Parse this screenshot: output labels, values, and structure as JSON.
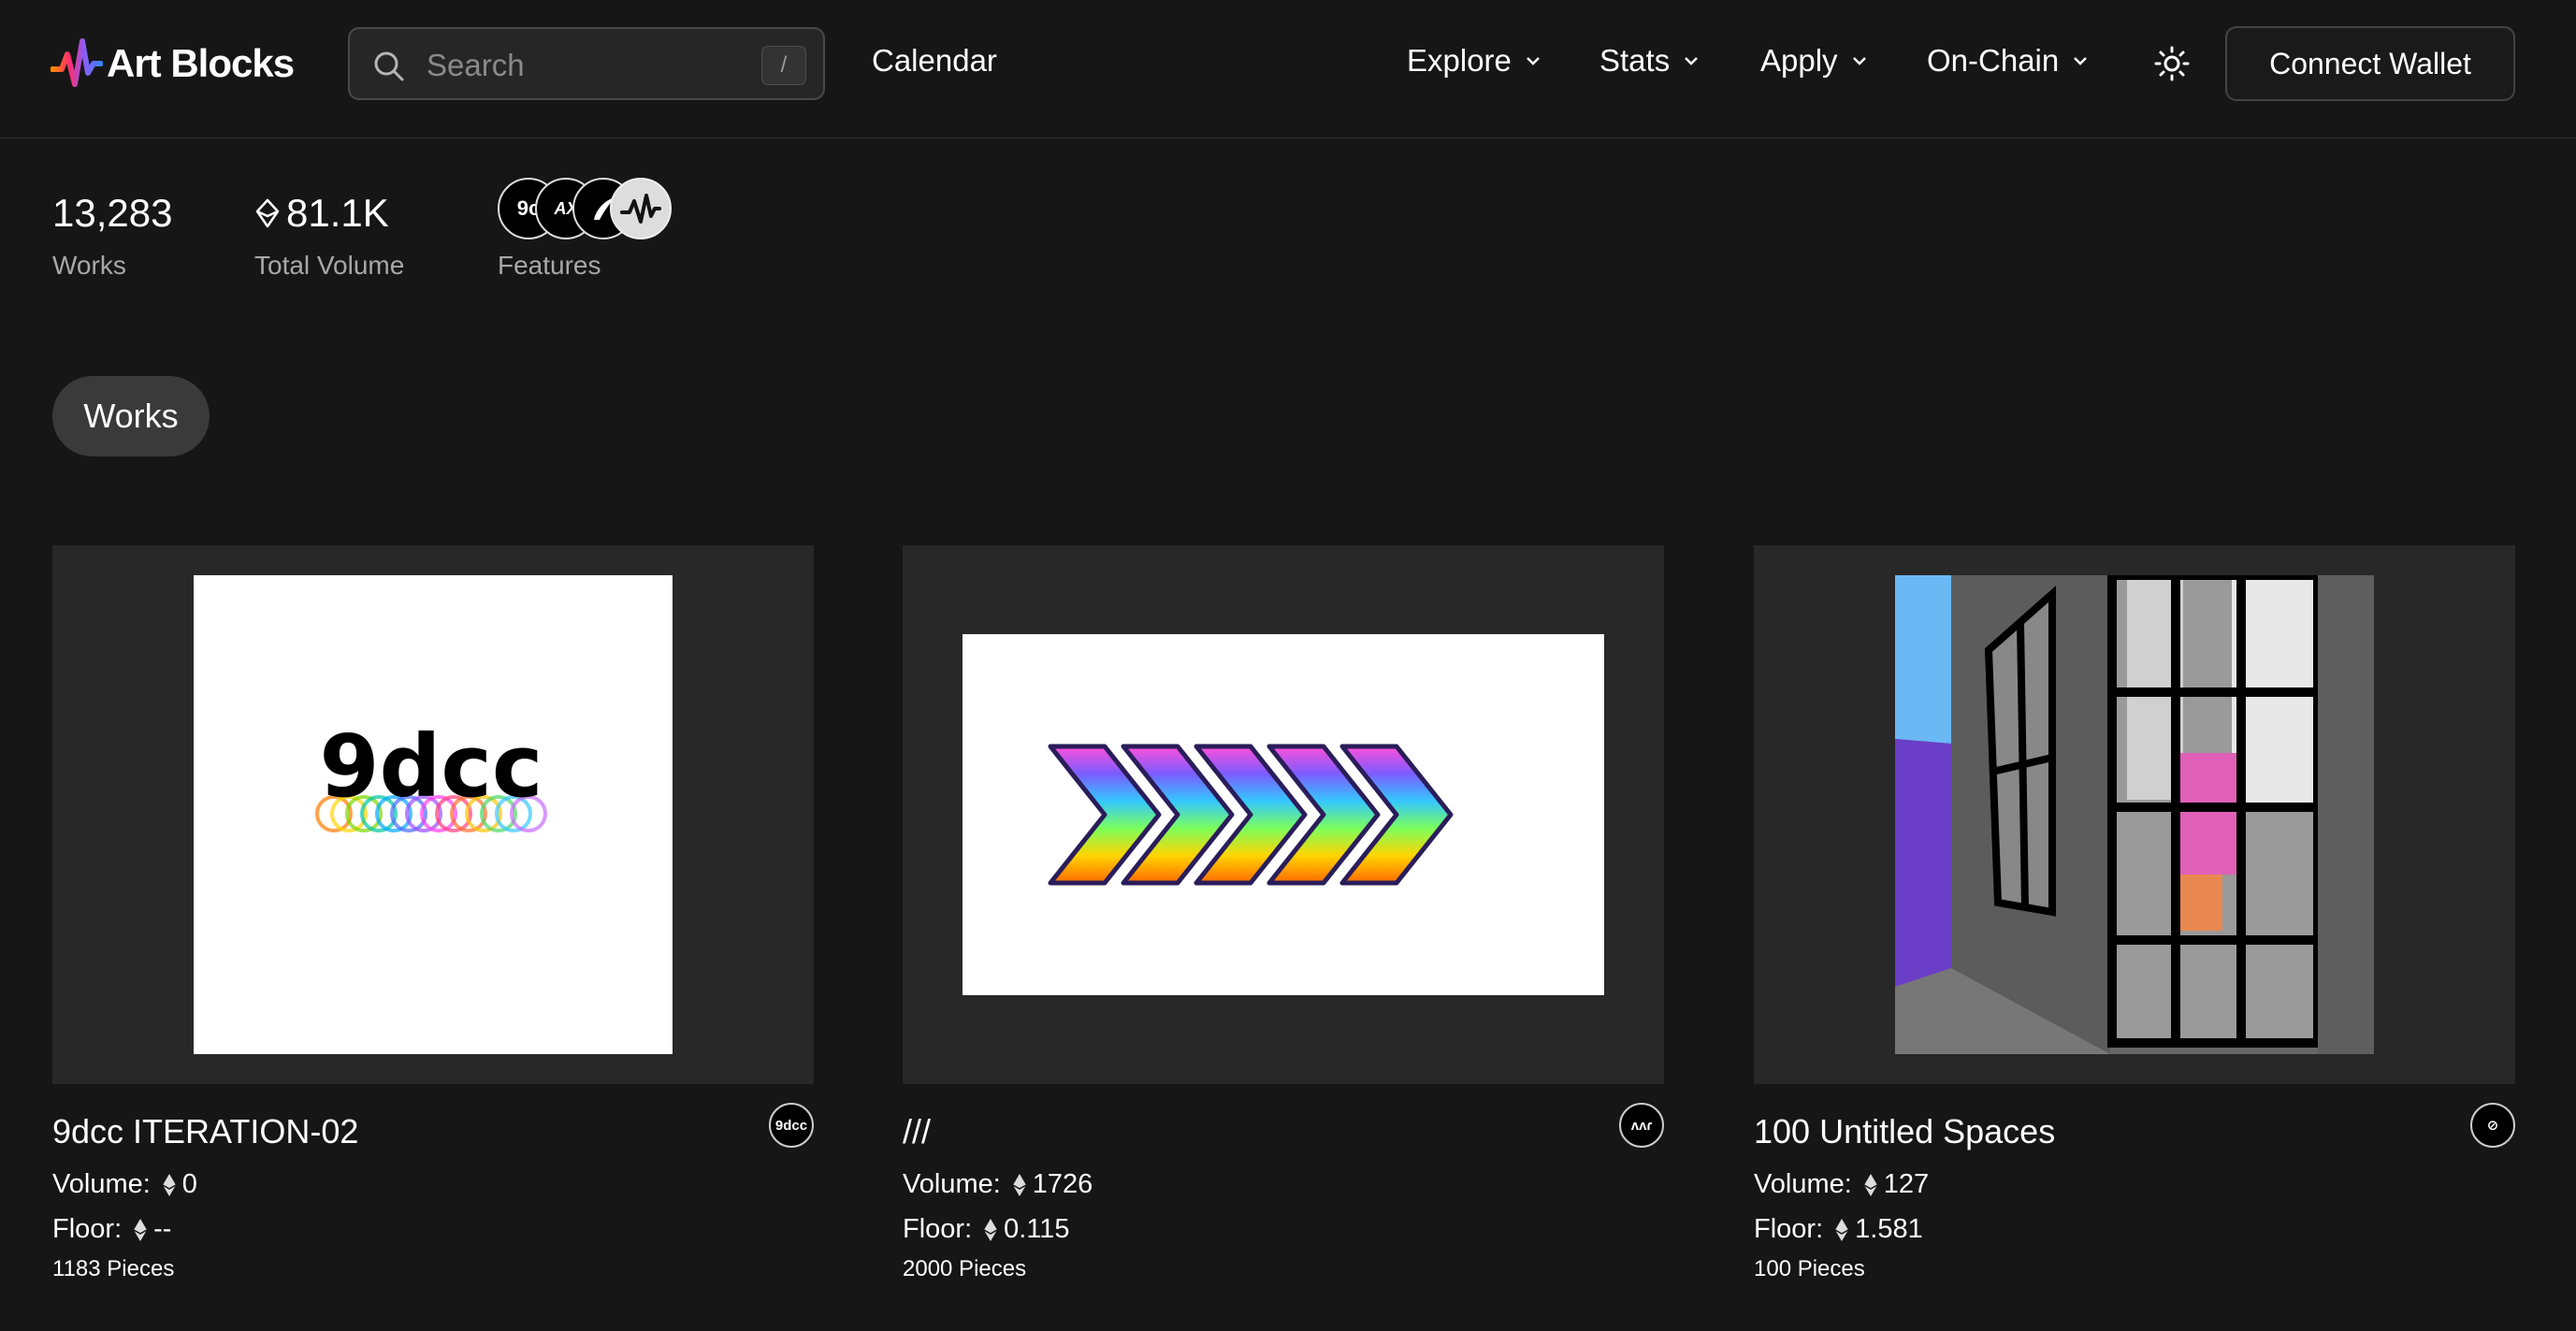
{
  "header": {
    "logo_text": "Art Blocks",
    "search": {
      "placeholder": "Search",
      "shortcut": "/"
    },
    "nav": {
      "calendar": "Calendar",
      "explore": "Explore",
      "stats": "Stats",
      "apply": "Apply",
      "onchain": "On-Chain"
    },
    "connect_wallet": "Connect Wallet"
  },
  "stats": {
    "works_value": "13,283",
    "works_label": "Works",
    "volume_value": "81.1K",
    "volume_label": "Total Volume",
    "features_label": "Features",
    "features": [
      {
        "text": "9c",
        "icon": "9dcc-logo"
      },
      {
        "text": "AX",
        "icon": "ax-logo"
      },
      {
        "text": "",
        "icon": "brush-logo"
      },
      {
        "text": "",
        "icon": "art-blocks-logo"
      }
    ]
  },
  "tabs": {
    "works": "Works"
  },
  "cards": [
    {
      "title": "9dcc ITERATION-02",
      "volume_label": "Volume:",
      "volume": "0",
      "floor_label": "Floor:",
      "floor": "--",
      "pieces": "1183 Pieces",
      "artist_badge": "9dcc",
      "art_text": "9dcc"
    },
    {
      "title": "///",
      "volume_label": "Volume:",
      "volume": "1726",
      "floor_label": "Floor:",
      "floor": "0.115",
      "pieces": "2000 Pieces",
      "artist_badge": "ʌʌɾ"
    },
    {
      "title": "100 Untitled Spaces",
      "volume_label": "Volume:",
      "volume": "127",
      "floor_label": "Floor:",
      "floor": "1.581",
      "pieces": "100 Pieces",
      "artist_badge": "⊘"
    }
  ],
  "colors": {
    "background": "#161616",
    "card_bg": "#282828",
    "muted_text": "#a8a8a8"
  }
}
